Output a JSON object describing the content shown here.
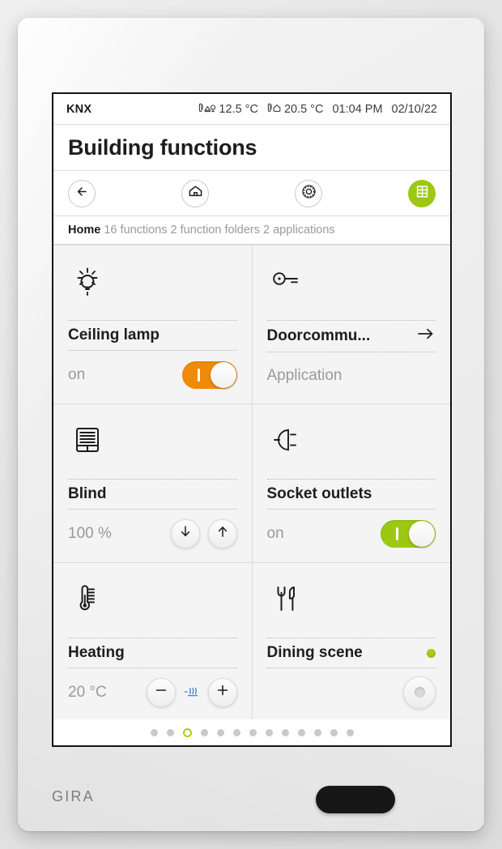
{
  "device": {
    "brand": "GIRA",
    "home_button": "home-key"
  },
  "statusbar": {
    "system_label": "KNX",
    "outdoor": {
      "icon": "thermometer-outdoor-icon",
      "value": "12.5 °C"
    },
    "indoor": {
      "icon": "thermometer-indoor-icon",
      "value": "20.5 °C"
    },
    "time": "01:04 PM",
    "date": "02/10/22"
  },
  "header": {
    "title": "Building functions"
  },
  "navbar": {
    "items": [
      {
        "name": "back-button",
        "icon": "arrow-left-icon",
        "accent": false
      },
      {
        "name": "home-button",
        "icon": "house-icon",
        "accent": false
      },
      {
        "name": "settings-button",
        "icon": "gear-icon",
        "accent": false
      },
      {
        "name": "grid-view-button",
        "icon": "grid-icon",
        "accent": true
      }
    ]
  },
  "breadcrumb": {
    "location": "Home",
    "summary": "16 functions 2 function folders 2 applications"
  },
  "tiles": [
    {
      "name": "Ceiling lamp",
      "icon": "light-bulb-icon",
      "state": "on",
      "control": "toggle",
      "toggle_on": true,
      "toggle_color": "#f08b0a"
    },
    {
      "name": "Doorcommu...",
      "icon": "key-icon",
      "state": "Application",
      "control": "link",
      "link_icon": "arrow-right-icon"
    },
    {
      "name": "Blind",
      "icon": "blind-icon",
      "state": "100 %",
      "control": "updown",
      "down_icon": "arrow-down-icon",
      "up_icon": "arrow-up-icon"
    },
    {
      "name": "Socket outlets",
      "icon": "plug-icon",
      "state": "on",
      "control": "toggle",
      "toggle_on": true,
      "toggle_color": "#9cc813"
    },
    {
      "name": "Heating",
      "icon": "thermometer-scale-icon",
      "state": "20 °C",
      "control": "stepper",
      "minus_icon": "minus-icon",
      "plus_icon": "plus-icon",
      "status_icon": "heating-waves-icon",
      "status_icon_color": "#4d7fd6"
    },
    {
      "name": "Dining scene",
      "icon": "cutlery-icon",
      "state": "",
      "control": "scene",
      "indicator_color": "#a8ce18",
      "scene_button": "scene-recall-button"
    }
  ],
  "pager": {
    "total": 13,
    "active_index": 3,
    "active_color": "#a8ce18"
  }
}
